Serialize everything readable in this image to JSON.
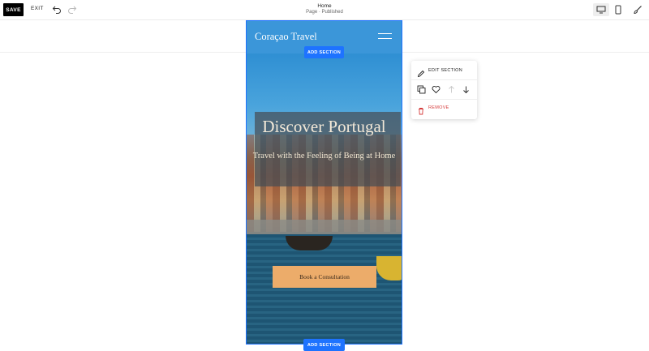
{
  "toolbar": {
    "save_label": "SAVE",
    "exit_label": "EXIT",
    "page_title": "Home",
    "page_status": "Page · Published"
  },
  "icons": {
    "undo": "undo-icon",
    "redo": "redo-icon",
    "desktop": "desktop-icon",
    "mobile": "mobile-icon",
    "design": "paintbrush-icon",
    "menu": "hamburger-icon",
    "edit": "pencil-icon",
    "duplicate": "duplicate-icon",
    "save_section": "heart-icon",
    "move_up": "arrow-up-icon",
    "move_down": "arrow-down-icon",
    "remove": "trash-icon"
  },
  "site": {
    "title": "Coraçao Travel",
    "hero_heading": "Discover Portugal",
    "hero_subheading": "Travel with the Feeling of Being at Home",
    "cta_label": "Book a Consultation"
  },
  "editor": {
    "add_section_top": "ADD SECTION",
    "add_section_bottom": "ADD SECTION"
  },
  "section_menu": {
    "edit_label": "EDIT SECTION",
    "remove_label": "REMOVE"
  },
  "colors": {
    "accent_blue": "#1e73ff",
    "cta_orange": "#ecac6a",
    "remove_red": "#d63b3b"
  }
}
